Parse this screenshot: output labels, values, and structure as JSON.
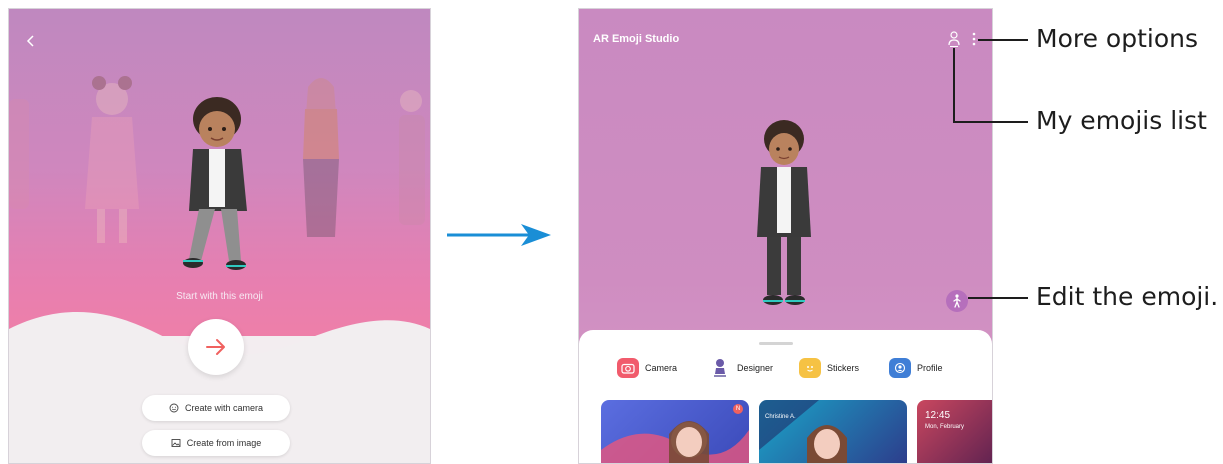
{
  "left_screen": {
    "start_label": "Start with this emoji",
    "create_camera_label": "Create with camera",
    "create_image_label": "Create from image"
  },
  "right_screen": {
    "title": "AR Emoji Studio",
    "menu": [
      {
        "label": "Camera",
        "icon": "camera-icon",
        "color": "#f15b6c"
      },
      {
        "label": "Designer",
        "icon": "designer-icon",
        "color": "#6a5aa8"
      },
      {
        "label": "Stickers",
        "icon": "stickers-icon",
        "color": "#f6c244"
      },
      {
        "label": "Profile",
        "icon": "profile-icon",
        "color": "#3f7ed6"
      }
    ],
    "thumbnails": [
      {
        "badge": "N"
      },
      {
        "caller": "Christine A."
      },
      {
        "time": "12:45",
        "date": "Mon, February"
      }
    ]
  },
  "callouts": {
    "more_options": "More options",
    "my_emojis_list": "My emojis list",
    "edit_emoji": "Edit the emoji."
  },
  "colors": {
    "accent_arrow": "#1a8ed6",
    "go_arrow": "#f0615f",
    "edit_button": "#b66fbc"
  }
}
